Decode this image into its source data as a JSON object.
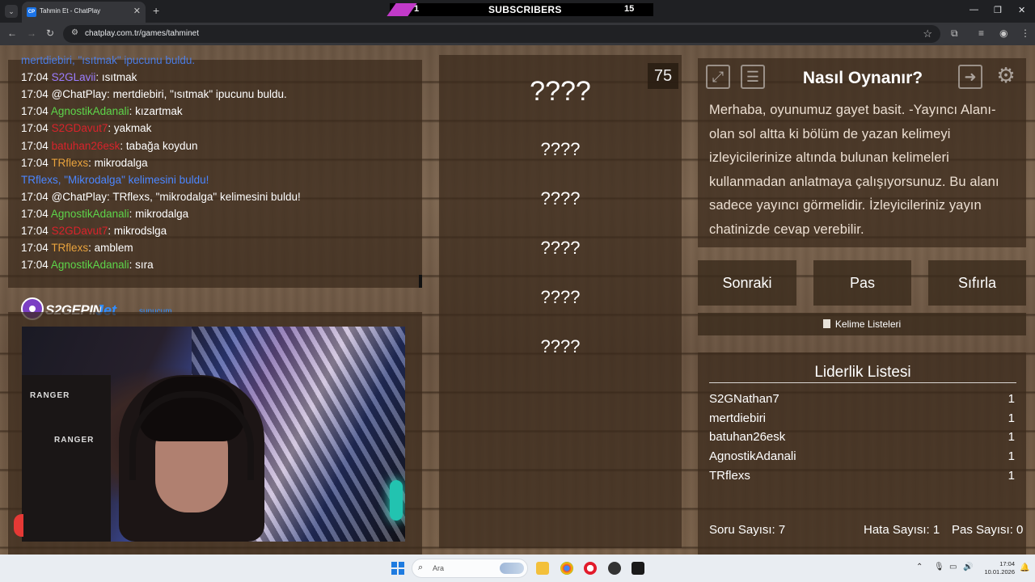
{
  "browser": {
    "tab_title": "Tahmin Et - ChatPlay",
    "favicon_text": "CP",
    "url": "chatplay.com.tr/games/tahminet",
    "subscribers": {
      "left_count": "1",
      "label": "SUBSCRIBERS",
      "right_count": "15"
    }
  },
  "chat": {
    "messages": [
      {
        "time": "",
        "user": "mertdiebiri, \"ısıtmak\" ipucunu buldu.",
        "sep": "",
        "text": "",
        "color": "blue"
      },
      {
        "time": "17:04",
        "user": "S2GLavii",
        "sep": ":",
        "text": " ısıtmak",
        "color": "violet"
      },
      {
        "time": "17:04",
        "user": "@ChatPlay",
        "sep": ":",
        "text": " mertdiebiri, \"ısıtmak\" ipucunu buldu.",
        "color": "white"
      },
      {
        "time": "17:04",
        "user": "AgnostikAdanali",
        "sep": ":",
        "text": " kızartmak",
        "color": "green"
      },
      {
        "time": "17:04",
        "user": "S2GDavut7",
        "sep": ":",
        "text": " yakmak",
        "color": "red"
      },
      {
        "time": "17:04",
        "user": "batuhan26esk",
        "sep": ":",
        "text": " tabağa koydun",
        "color": "red"
      },
      {
        "time": "17:04",
        "user": "TRflexs",
        "sep": ":",
        "text": " mikrodalga",
        "color": "orange"
      },
      {
        "time": "",
        "user": "TRflexs, \"Mikrodalga\" kelimesini buldu!",
        "sep": "",
        "text": "",
        "color": "blue"
      },
      {
        "time": "17:04",
        "user": "@ChatPlay",
        "sep": ":",
        "text": " TRflexs, \"mikrodalga\" kelimesini buldu!",
        "color": "white"
      },
      {
        "time": "17:04",
        "user": "AgnostikAdanali",
        "sep": ":",
        "text": " mikrodalga",
        "color": "green"
      },
      {
        "time": "17:04",
        "user": "S2GDavut7",
        "sep": ":",
        "text": " mikrodslga",
        "color": "red"
      },
      {
        "time": "17:04",
        "user": "TRflexs",
        "sep": ":",
        "text": " amblem",
        "color": "orange"
      },
      {
        "time": "17:04",
        "user": "AgnostikAdanali",
        "sep": ":",
        "text": " sıra",
        "color": "green"
      }
    ]
  },
  "brand": {
    "name1": "S2GEPIN",
    "name2": "Jet",
    "tagline": "sunucum"
  },
  "webcam": {
    "chair_text": "RANGER"
  },
  "board": {
    "timer": "75",
    "main_word": "????",
    "words": [
      "????",
      "????",
      "????",
      "????",
      "????"
    ]
  },
  "howto": {
    "title": "Nasıl Oynanır?",
    "text": "Merhaba, oyunumuz gayet basit. -Yayıncı Alanı- olan sol altta ki bölüm de yazan kelimeyi izleyicilerinize altında bulunan kelimeleri kullanmadan anlatmaya çalışıyorsunuz. Bu alanı sadece yayıncı görmelidir. İzleyicileriniz yayın chatinizde cevap verebilir."
  },
  "actions": {
    "next": "Sonraki",
    "pass": "Pas",
    "reset": "Sıfırla",
    "word_lists": "Kelime Listeleri"
  },
  "leaderboard": {
    "title": "Liderlik Listesi",
    "rows": [
      {
        "name": "S2GNathan7",
        "score": "1"
      },
      {
        "name": "mertdiebiri",
        "score": "1"
      },
      {
        "name": "batuhan26esk",
        "score": "1"
      },
      {
        "name": "AgnostikAdanali",
        "score": "1"
      },
      {
        "name": "TRflexs",
        "score": "1"
      }
    ]
  },
  "stats": {
    "questions": "Soru Sayısı: 7",
    "errors": "Hata Sayısı: 1",
    "passes": "Pas Sayısı: 0"
  },
  "taskbar": {
    "search_placeholder": "Ara",
    "time": "17:04",
    "date": "10.01.2026"
  },
  "colors": {
    "wood": "#6b5643",
    "panel": "#3a2a1c",
    "chat_blue": "#4b86ff",
    "chat_green": "#5dd54a",
    "chat_red": "#d8232b",
    "chat_orange": "#e8a23d"
  }
}
